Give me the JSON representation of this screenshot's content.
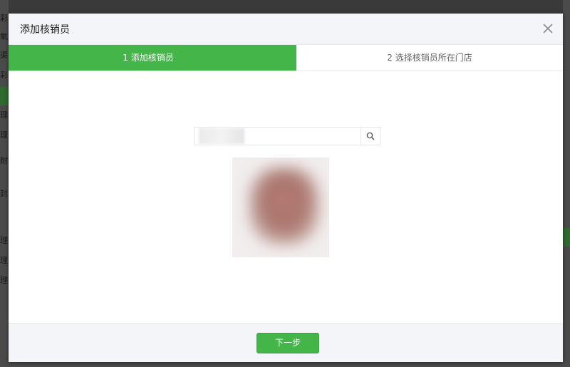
{
  "background": {
    "left_edge_chars": [
      "彩",
      "氧",
      "渠",
      "彩",
      "理",
      "理",
      "耐",
      "封",
      "理",
      "理",
      "理"
    ]
  },
  "modal": {
    "title": "添加核销员",
    "close_icon": "close-icon",
    "steps": [
      {
        "label": "1 添加核销员",
        "active": true
      },
      {
        "label": "2 选择核销员所在门店",
        "active": false
      }
    ],
    "search": {
      "value": "",
      "icon": "search-icon"
    },
    "avatar_icon": "avatar",
    "next_label": "下一步"
  },
  "colors": {
    "accent": "#44b549",
    "header_bg": "#f4f5f9",
    "border": "#e7e7eb"
  }
}
